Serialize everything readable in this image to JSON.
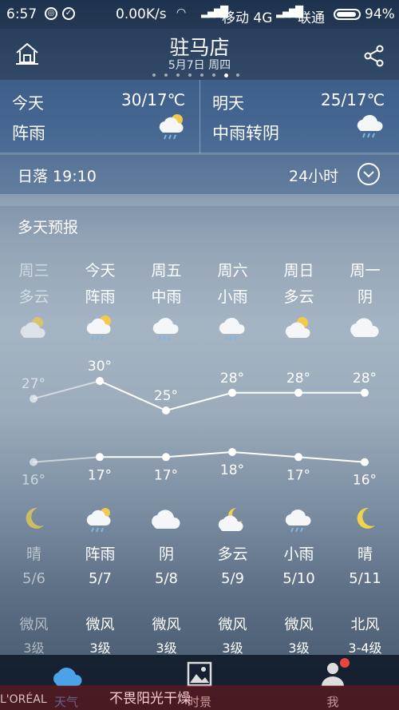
{
  "status_bar": {
    "time": "6:57",
    "net_speed": "0.00K/s",
    "carrier1": "移动 4G",
    "carrier2": "联通",
    "battery": "94%",
    "battery_level": 0.94
  },
  "header": {
    "city": "驻马店",
    "date": "5月7日 周四",
    "page_count": 8,
    "active_page": 7
  },
  "today": {
    "label": "今天",
    "temp": "30/17℃",
    "condition": "阵雨",
    "icon": "sun-shower-icon"
  },
  "tomorrow": {
    "label": "明天",
    "temp": "25/17℃",
    "condition": "中雨转阴",
    "icon": "rain-cloud-icon"
  },
  "sunset": {
    "text": "日落 19:10",
    "hourly_label": "24小时"
  },
  "forecast": {
    "title": "多天预报",
    "days": [
      {
        "day": "周三",
        "cond_day": "多云",
        "day_icon": "partly-sunny-icon",
        "high": "27°",
        "low": "16°",
        "night_icon": "moon-icon",
        "cond_night": "晴",
        "date": "5/6",
        "wind": "微风",
        "level": "3级",
        "past": true
      },
      {
        "day": "今天",
        "cond_day": "阵雨",
        "day_icon": "sun-shower-icon",
        "high": "30°",
        "low": "17°",
        "night_icon": "cloud-rain-icon",
        "cond_night": "阵雨",
        "date": "5/7",
        "wind": "微风",
        "level": "3级",
        "past": false
      },
      {
        "day": "周五",
        "cond_day": "中雨",
        "day_icon": "rain-cloud-icon",
        "high": "25°",
        "low": "17°",
        "night_icon": "cloud-icon",
        "cond_night": "阴",
        "date": "5/8",
        "wind": "微风",
        "level": "3级",
        "past": false
      },
      {
        "day": "周六",
        "cond_day": "小雨",
        "day_icon": "rain-cloud-icon",
        "high": "28°",
        "low": "18°",
        "night_icon": "moon-cloud-icon",
        "cond_night": "多云",
        "date": "5/9",
        "wind": "微风",
        "level": "3级",
        "past": false
      },
      {
        "day": "周日",
        "cond_day": "多云",
        "day_icon": "partly-sunny-icon",
        "high": "28°",
        "low": "17°",
        "night_icon": "rain-cloud-icon",
        "cond_night": "小雨",
        "date": "5/10",
        "wind": "微风",
        "level": "3级",
        "past": false
      },
      {
        "day": "周一",
        "cond_day": "阴",
        "day_icon": "cloud-icon",
        "high": "28°",
        "low": "16°",
        "night_icon": "moon-icon",
        "cond_night": "晴",
        "date": "5/11",
        "wind": "北风",
        "level": "3-4级",
        "past": false
      }
    ]
  },
  "chart_data": {
    "type": "line",
    "categories": [
      "5/6",
      "5/7",
      "5/8",
      "5/9",
      "5/10",
      "5/11"
    ],
    "series": [
      {
        "values": [
          27,
          30,
          25,
          28,
          28,
          28
        ]
      },
      {
        "values": [
          16,
          17,
          17,
          18,
          17,
          16
        ]
      }
    ]
  },
  "tabs": [
    {
      "label": "天气",
      "icon": "cloud-tab-icon",
      "active": true
    },
    {
      "label": "时景",
      "icon": "photo-icon",
      "active": false
    },
    {
      "label": "我",
      "icon": "person-icon",
      "active": false
    }
  ],
  "ad": {
    "text": "不畏阳光干燥",
    "brand": "L'ORÉAL"
  },
  "colors": {
    "accent": "#4aa3e8",
    "badge": "#e8453c"
  }
}
